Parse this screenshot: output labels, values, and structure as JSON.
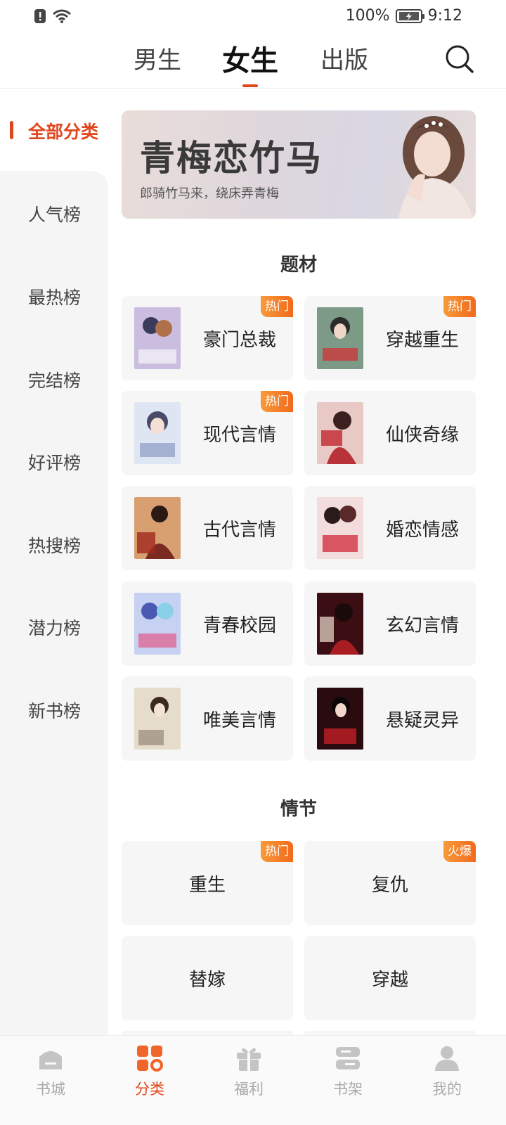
{
  "status": {
    "battery": "100%",
    "time": "9:12"
  },
  "top_tabs": [
    {
      "label": "男生"
    },
    {
      "label": "女生"
    },
    {
      "label": "出版"
    }
  ],
  "sidebar": {
    "items": [
      {
        "label": "全部分类"
      },
      {
        "label": "人气榜"
      },
      {
        "label": "最热榜"
      },
      {
        "label": "完结榜"
      },
      {
        "label": "好评榜"
      },
      {
        "label": "热搜榜"
      },
      {
        "label": "潜力榜"
      },
      {
        "label": "新书榜"
      }
    ]
  },
  "banner": {
    "title": "青梅恋竹马",
    "subtitle": "郎骑竹马来，绕床弄青梅"
  },
  "sections": {
    "topics_title": "题材",
    "plot_title": "情节"
  },
  "topics": [
    {
      "label": "豪门总裁",
      "badge": "热门",
      "cover_color": "#c9b9d8",
      "cover_text": "独少的替嫁甜妻"
    },
    {
      "label": "穿越重生",
      "badge": "热门",
      "cover_color": "#7d9a86",
      "cover_text": "鬼医毒妻"
    },
    {
      "label": "现代言情",
      "badge": "热门",
      "cover_color": "#cfd7ea",
      "cover_text": "厉少宠妻至上"
    },
    {
      "label": "仙侠奇缘",
      "badge": "",
      "cover_color": "#b8525a",
      "cover_text": "绝色倾城"
    },
    {
      "label": "古代言情",
      "badge": "",
      "cover_color": "#b97352",
      "cover_text": "嫡女王妃"
    },
    {
      "label": "婚恋情感",
      "badge": "",
      "cover_color": "#d98a8a",
      "cover_text": "夫人哪里跑"
    },
    {
      "label": "青春校园",
      "badge": "",
      "cover_color": "#a9b6e0",
      "cover_text": "误闯美男集中营"
    },
    {
      "label": "玄幻言情",
      "badge": "",
      "cover_color": "#5a1a1f",
      "cover_text": "鬼医嫡女"
    },
    {
      "label": "唯美言情",
      "badge": "",
      "cover_color": "#d8cbb6",
      "cover_text": "暴君"
    },
    {
      "label": "悬疑灵异",
      "badge": "",
      "cover_color": "#3a1418",
      "cover_text": "闺王妃"
    }
  ],
  "plots": [
    {
      "label": "重生",
      "badge": "热门"
    },
    {
      "label": "复仇",
      "badge": "火爆"
    },
    {
      "label": "替嫁",
      "badge": ""
    },
    {
      "label": "穿越",
      "badge": ""
    }
  ],
  "bottom_nav": [
    {
      "label": "书城",
      "icon": "home-icon"
    },
    {
      "label": "分类",
      "icon": "category-icon"
    },
    {
      "label": "福利",
      "icon": "gift-icon"
    },
    {
      "label": "书架",
      "icon": "bookshelf-icon"
    },
    {
      "label": "我的",
      "icon": "profile-icon"
    }
  ],
  "colors": {
    "accent": "#e2461d",
    "badge_start": "#f79a3a",
    "badge_end": "#f26a1c"
  }
}
